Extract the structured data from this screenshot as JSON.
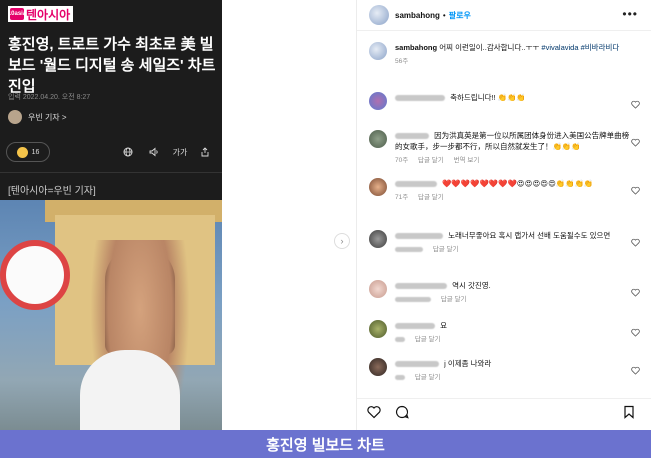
{
  "article": {
    "logo": "텐아시아",
    "logo_mark": "10asia",
    "title": "홍진영, 트로트 가수 최초로 美 빌보드 '월드 디지털 송 세일즈' 차트 진입",
    "date": "입력 2022.04.20. 오전 8:27",
    "reporter": "우빈 기자 >",
    "reaction_count": "16",
    "caption": "[텐아시아=우빈 기자]",
    "tool_icons": [
      "globe-icon",
      "speaker-icon",
      "font-size-icon",
      "share-icon"
    ],
    "font_label": "가가"
  },
  "instagram": {
    "username": "sambahong",
    "follow_label": "팔로우",
    "dot": "•",
    "caption_text": "어찌 이런일이..감사합니다..ㅜㅜ",
    "caption_tags": "#vivalavida #비바라비다",
    "caption_time": "56주",
    "comments": [
      {
        "text": "축하드립니다!! 👏👏👏",
        "meta": [],
        "heart": true
      },
      {
        "text": "因为洪真英是第一位以所属团体身份进入美国公告牌单曲榜的女歌手，步一步都不行，所以自然就发生了！👏👏👏",
        "meta": [
          "70주",
          "답글 달기",
          "번역 보기"
        ],
        "heart": true
      },
      {
        "text": "❤️❤️❤️❤️❤️❤️❤️❤️😍😍😍😍😍👏👏👏👏",
        "meta": [
          "71주",
          "답글 달기"
        ],
        "heart": true
      },
      {
        "text": "노래너무좋아요 혹시 랩가서 선배 도움될수도 있으면",
        "meta": [
          "답글 달기"
        ],
        "heart": true
      },
      {
        "text": "역시 갓진영.",
        "meta": [
          "답글 달기"
        ],
        "heart": true
      },
      {
        "text": "요",
        "meta": [
          "답글 달기"
        ],
        "heart": true
      },
      {
        "text": "j 이제좀 나와라",
        "meta": [
          "답글 달기"
        ],
        "heart": true
      }
    ],
    "action_icons": [
      "heart-icon",
      "comment-icon",
      "bookmark-icon"
    ]
  },
  "banner": {
    "text": "홍진영 빌보드 차트"
  },
  "colors": {
    "article_bg": "#1c1c1c",
    "brand_pink": "#e5006a",
    "follow_blue": "#0095f6",
    "banner": "#6b72cf"
  }
}
